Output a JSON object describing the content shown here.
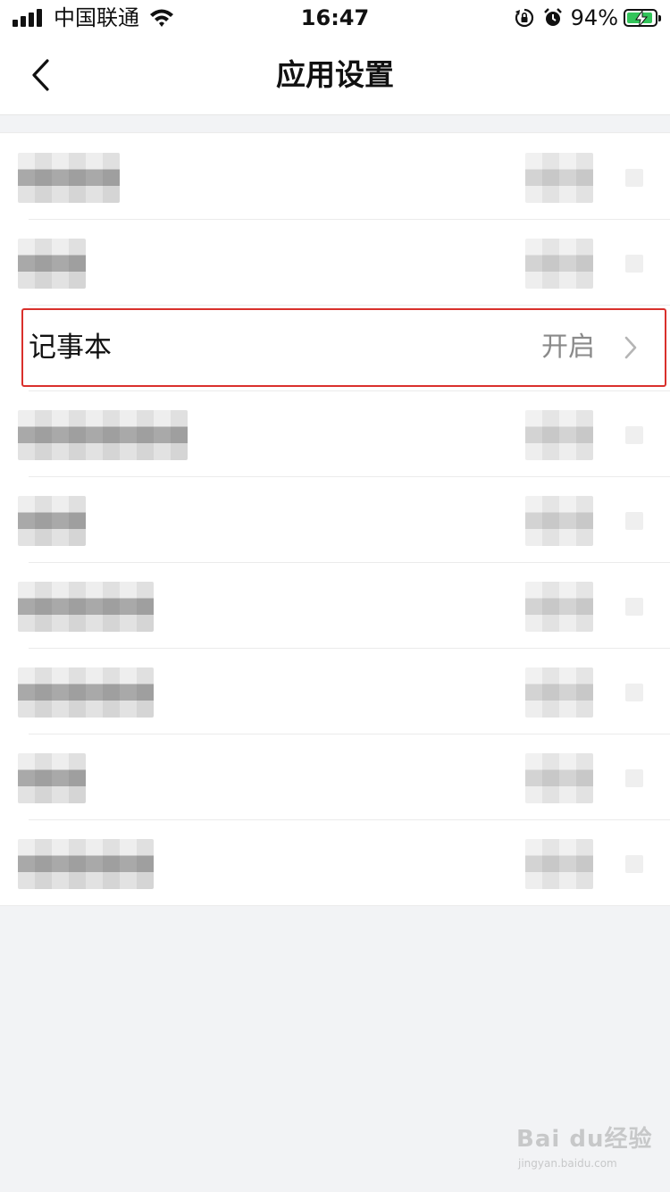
{
  "status_bar": {
    "carrier": "中国联通",
    "time": "16:47",
    "battery_percent": "94%",
    "battery_level": 0.94,
    "icons": [
      "signal-icon",
      "wifi-icon",
      "orientation-lock-icon",
      "alarm-icon",
      "battery-charging-icon"
    ]
  },
  "nav": {
    "title": "应用设置",
    "back_icon": "chevron-left-icon"
  },
  "list": {
    "highlighted_item": {
      "label": "记事本",
      "value": "开启",
      "icon": "chevron-right-icon"
    }
  },
  "colors": {
    "background": "#f2f3f5",
    "highlight_border": "#d9302c",
    "value_text": "#8a8a8a",
    "battery_fill": "#33c45a"
  },
  "watermark": {
    "brand": "Bai du经验",
    "url": "jingyan.baidu.com"
  }
}
